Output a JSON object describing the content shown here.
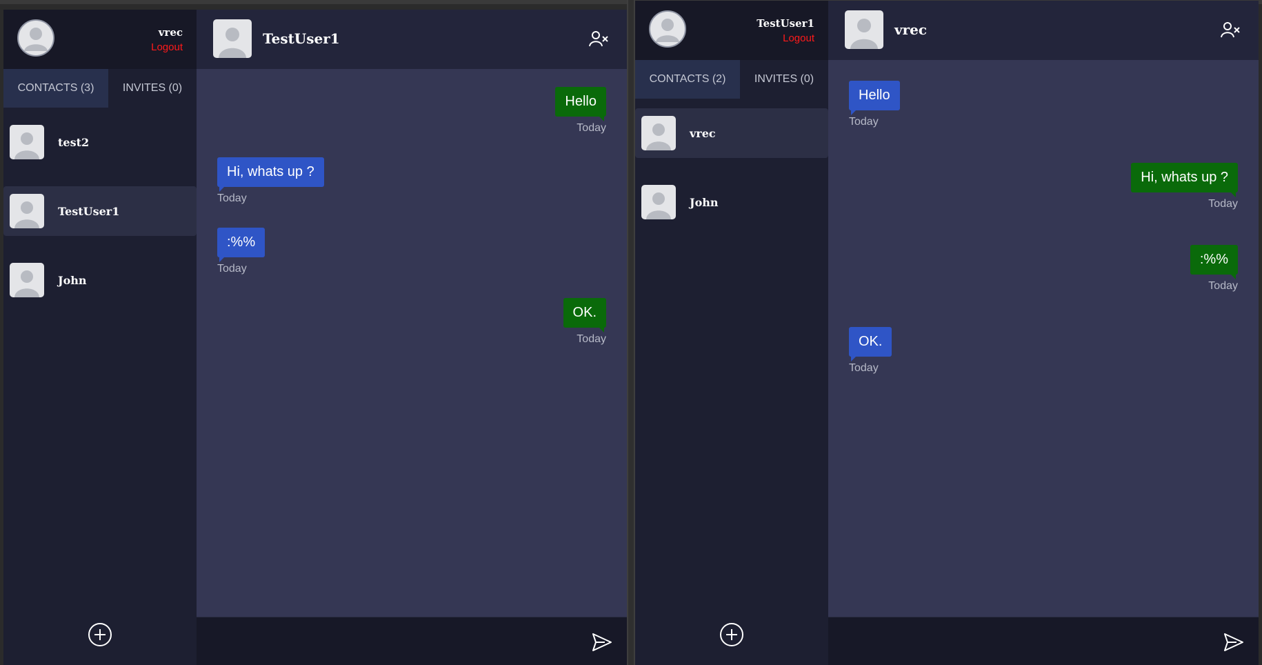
{
  "colors": {
    "incoming_bubble": "#2f55c6",
    "outgoing_bubble": "#0a6a0a",
    "logout": "#ff1a1a",
    "sidebar": "#1d1f31",
    "chat_bg": "#353754"
  },
  "left_window": {
    "profile": {
      "username": "vrec",
      "logout_label": "Logout",
      "avatar_icon": "user-avatar-icon"
    },
    "tabs": [
      {
        "label": "CONTACTS (3)",
        "active": true
      },
      {
        "label": "INVITES (0)",
        "active": false
      }
    ],
    "contacts": [
      {
        "name": "test2",
        "selected": false
      },
      {
        "name": "TestUser1",
        "selected": true
      },
      {
        "name": "John",
        "selected": false
      }
    ],
    "add_icon": "add-circle-icon",
    "chat": {
      "contact_name": "TestUser1",
      "remove_icon": "remove-user-icon",
      "messages": [
        {
          "text": "Hello",
          "time": "Today",
          "direction": "outgoing"
        },
        {
          "text": "Hi, whats up ?",
          "time": "Today",
          "direction": "incoming"
        },
        {
          "text": ":%%",
          "time": "Today",
          "direction": "incoming"
        },
        {
          "text": "OK.",
          "time": "Today",
          "direction": "outgoing"
        }
      ],
      "input_value": "",
      "send_icon": "send-icon"
    }
  },
  "right_window": {
    "profile": {
      "username": "TestUser1",
      "logout_label": "Logout",
      "avatar_icon": "user-avatar-icon"
    },
    "tabs": [
      {
        "label": "CONTACTS (2)",
        "active": true
      },
      {
        "label": "INVITES (0)",
        "active": false
      }
    ],
    "contacts": [
      {
        "name": "vrec",
        "selected": true
      },
      {
        "name": "John",
        "selected": false
      }
    ],
    "add_icon": "add-circle-icon",
    "chat": {
      "contact_name": "vrec",
      "remove_icon": "remove-user-icon",
      "messages": [
        {
          "text": "Hello",
          "time": "Today",
          "direction": "incoming"
        },
        {
          "text": "Hi, whats up ?",
          "time": "Today",
          "direction": "outgoing"
        },
        {
          "text": ":%%",
          "time": "Today",
          "direction": "outgoing"
        },
        {
          "text": "OK.",
          "time": "Today",
          "direction": "incoming"
        }
      ],
      "input_value": "",
      "send_icon": "send-icon"
    }
  }
}
